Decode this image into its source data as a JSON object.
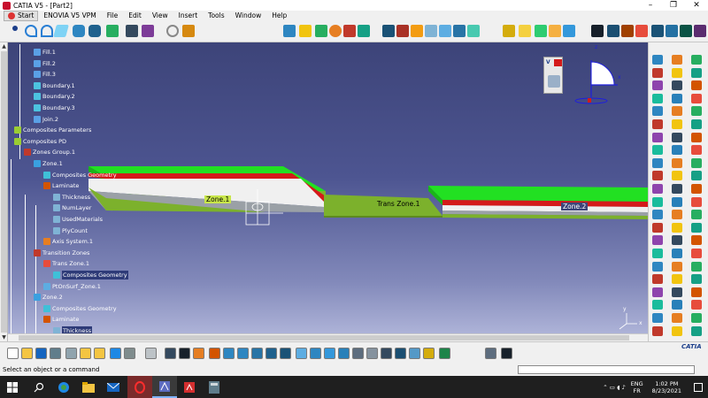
{
  "window": {
    "title": "CATIA V5 - [Part2]",
    "controls": [
      "–",
      "❐",
      "✕"
    ]
  },
  "menubar": {
    "start": "Start",
    "items": [
      "ENOVIA V5 VPM",
      "File",
      "Edit",
      "View",
      "Insert",
      "Tools",
      "Window",
      "Help"
    ]
  },
  "tree": [
    {
      "label": "Fill.1",
      "indent": 2,
      "icon": "fill-icon",
      "color": "#5aa0e6"
    },
    {
      "label": "Fill.2",
      "indent": 2,
      "icon": "fill-icon",
      "color": "#5aa0e6"
    },
    {
      "label": "Fill.3",
      "indent": 2,
      "icon": "fill-icon",
      "color": "#5aa0e6"
    },
    {
      "label": "Boundary.1",
      "indent": 2,
      "icon": "boundary-icon",
      "color": "#4cc3e0"
    },
    {
      "label": "Boundary.2",
      "indent": 2,
      "icon": "boundary-icon",
      "color": "#4cc3e0"
    },
    {
      "label": "Boundary.3",
      "indent": 2,
      "icon": "boundary-icon",
      "color": "#4cc3e0"
    },
    {
      "label": "Join.2",
      "indent": 2,
      "icon": "join-icon",
      "color": "#5aa0e6"
    },
    {
      "label": "Composites Parameters",
      "indent": 0,
      "icon": "composites-parameters-icon",
      "color": "#9acd32"
    },
    {
      "label": "Composites PD",
      "indent": 0,
      "icon": "composites-pd-icon",
      "color": "#9acd32"
    },
    {
      "label": "Zones Group.1",
      "indent": 1,
      "icon": "zones-group-icon",
      "color": "#c0392b"
    },
    {
      "label": "Zone.1",
      "indent": 2,
      "icon": "zone-icon",
      "color": "#3aa0e0"
    },
    {
      "label": "Composites Geometry",
      "indent": 3,
      "icon": "composites-geometry-icon",
      "color": "#3fc0d8"
    },
    {
      "label": "Laminate",
      "indent": 3,
      "icon": "laminate-icon",
      "color": "#d35400"
    },
    {
      "label": "Thickness",
      "indent": 4,
      "icon": "parameter-icon",
      "color": "#7fb3d5"
    },
    {
      "label": "NumLayer",
      "indent": 4,
      "icon": "parameter-icon",
      "color": "#7fb3d5"
    },
    {
      "label": "UsedMaterials",
      "indent": 4,
      "icon": "parameter-icon",
      "color": "#7fb3d5"
    },
    {
      "label": "PlyCount",
      "indent": 4,
      "icon": "parameter-icon",
      "color": "#7fb3d5"
    },
    {
      "label": "Axis System.1",
      "indent": 3,
      "icon": "axis-system-icon",
      "color": "#e67e22"
    },
    {
      "label": "Transition Zones",
      "indent": 2,
      "icon": "transition-zones-icon",
      "color": "#c0392b"
    },
    {
      "label": "Trans Zone.1",
      "indent": 3,
      "icon": "trans-zone-icon",
      "color": "#e74c3c"
    },
    {
      "label": "Composites Geometry",
      "indent": 4,
      "icon": "composites-geometry-icon",
      "color": "#3fc0d8",
      "highlight": true
    },
    {
      "label": "PtOnSurf_Zone.1",
      "indent": 3,
      "icon": "point-icon",
      "color": "#5dade2"
    },
    {
      "label": "Zone.2",
      "indent": 2,
      "icon": "zone-icon",
      "color": "#3aa0e0"
    },
    {
      "label": "Composites Geometry",
      "indent": 3,
      "icon": "composites-geometry-icon",
      "color": "#3fc0d8"
    },
    {
      "label": "Laminate",
      "indent": 3,
      "icon": "laminate-icon",
      "color": "#d35400"
    },
    {
      "label": "Thickness",
      "indent": 4,
      "icon": "parameter-icon",
      "color": "#7fb3d5",
      "highlight": true
    }
  ],
  "viewport": {
    "zone1_label": "Zone.1",
    "trans_zone_label": "Trans Zone.1",
    "zone2_label": "Zone.2",
    "compass_x": "x",
    "compass_z": "z",
    "axis_y": "y",
    "axis_x": "x",
    "colors": {
      "green": "#22e022",
      "olive": "#7cb12c",
      "red": "#d41a1a",
      "white": "#f0f0f0",
      "gray": "#9aa0a6"
    }
  },
  "statusbar": {
    "message": "Select an object or a command",
    "command_input": ""
  },
  "taskbar": {
    "icons": [
      "windows-start-icon",
      "search-icon",
      "edge-icon",
      "file-explorer-icon",
      "mail-icon",
      "opera-icon",
      "catia-icon",
      "acrobat-icon",
      "calculator-icon"
    ],
    "lang": "ENG",
    "region": "FR",
    "time": "1:02 PM",
    "date": "8/23/2021"
  },
  "brand": {
    "logo_text": "CATIA"
  }
}
